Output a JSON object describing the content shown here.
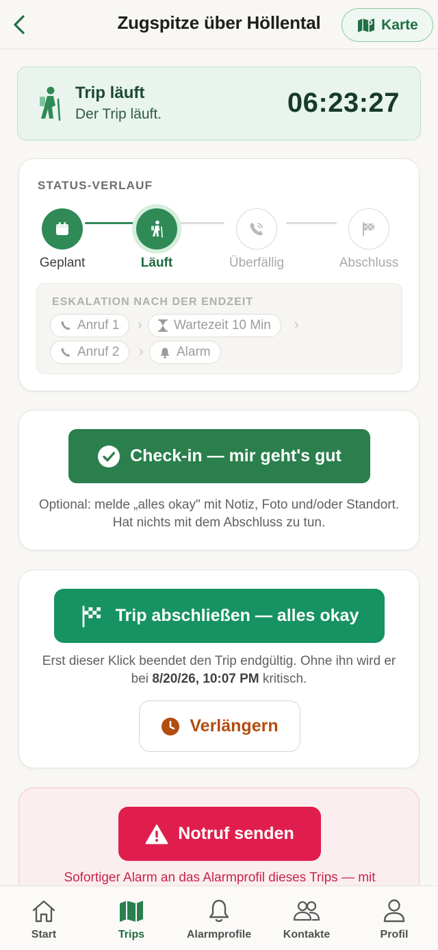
{
  "header": {
    "title": "Zugspitze über Höllental",
    "map_label": "Karte"
  },
  "running": {
    "title": "Trip läuft",
    "subtitle": "Der Trip läuft.",
    "timer": "06:23:27"
  },
  "status": {
    "heading": "STATUS-VERLAUF",
    "steps": [
      {
        "label": "Geplant",
        "state": "done",
        "icon": "calendar-icon"
      },
      {
        "label": "Läuft",
        "state": "active",
        "icon": "hiker-icon"
      },
      {
        "label": "Überfällig",
        "state": "todo",
        "icon": "phone-ringing-icon"
      },
      {
        "label": "Abschluss",
        "state": "todo",
        "icon": "checkered-flag-icon"
      }
    ],
    "escalation": {
      "heading": "ESKALATION NACH DER ENDZEIT",
      "chips": [
        "Anruf 1",
        "Wartezeit 10 Min",
        "Anruf 2",
        "Alarm"
      ]
    }
  },
  "checkin": {
    "button_label": "Check-in — mir geht's gut",
    "hint": "Optional: melde „alles okay\" mit Notiz, Foto und/oder Standort. Hat nichts mit dem Abschluss zu tun."
  },
  "finish": {
    "button_label": "Trip abschließen — alles okay",
    "hint_prefix": "Erst dieser Klick beendet den Trip endgültig. Ohne ihn wird er bei",
    "hint_deadline": "8/20/26, 10:07 PM",
    "hint_suffix": "kritisch.",
    "extend_label": "Verlängern"
  },
  "emergency": {
    "button_label": "Notruf senden",
    "hint": "Sofortiger Alarm an das Alarmprofil dieses Trips — mit"
  },
  "nav": {
    "items": [
      {
        "label": "Start",
        "icon": "house-icon",
        "active": false
      },
      {
        "label": "Trips",
        "icon": "map-icon",
        "active": true
      },
      {
        "label": "Alarmprofile",
        "icon": "bell-icon",
        "active": false
      },
      {
        "label": "Kontakte",
        "icon": "people-icon",
        "active": false
      },
      {
        "label": "Profil",
        "icon": "person-icon",
        "active": false
      }
    ]
  },
  "colors": {
    "primary_green": "#2a7f4d",
    "finish_green": "#179263",
    "extend_orange": "#b34c10",
    "emergency_red": "#e01e4e",
    "background": "#f8f7f4"
  }
}
